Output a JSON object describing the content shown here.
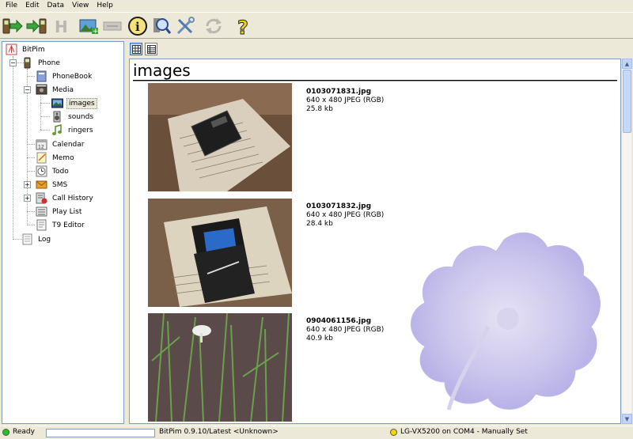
{
  "menubar": {
    "items": [
      "File",
      "Edit",
      "Data",
      "View",
      "Help"
    ]
  },
  "toolbar": {
    "buttons": [
      {
        "name": "get-phone-data",
        "icon": "phone-arrow-in-icon"
      },
      {
        "name": "send-phone-data",
        "icon": "phone-arrow-out-icon"
      },
      {
        "name": "history",
        "icon": "h-icon"
      },
      {
        "name": "add-image",
        "icon": "image-add-icon"
      },
      {
        "name": "delete",
        "icon": "delete-icon"
      },
      {
        "name": "info",
        "icon": "info-icon"
      },
      {
        "name": "find-phone",
        "icon": "magnifier-phone-icon"
      },
      {
        "name": "settings",
        "icon": "tools-icon"
      },
      {
        "name": "refresh",
        "icon": "refresh-icon"
      },
      {
        "name": "help",
        "icon": "help-icon"
      }
    ]
  },
  "tree": {
    "root": "BitPim",
    "phone": "Phone",
    "phonebook": "PhoneBook",
    "media": "Media",
    "images": "images",
    "sounds": "sounds",
    "ringers": "ringers",
    "calendar": "Calendar",
    "memo": "Memo",
    "todo": "Todo",
    "sms": "SMS",
    "call_history": "Call History",
    "play_list": "Play List",
    "t9_editor": "T9 Editor",
    "log": "Log"
  },
  "content": {
    "heading": "images",
    "items": [
      {
        "filename": "0103071831.jpg",
        "dims": "640 x 480 JPEG (RGB)",
        "size": "25.8 kb"
      },
      {
        "filename": "0103071832.jpg",
        "dims": "640 x 480 JPEG (RGB)",
        "size": "28.4 kb"
      },
      {
        "filename": "0904061156.jpg",
        "dims": "640 x 480 JPEG (RGB)",
        "size": "40.9 kb"
      }
    ]
  },
  "status": {
    "ready": "Ready",
    "version": "BitPim 0.9.10/Latest <Unknown>",
    "phone": "LG-VX5200 on COM4 - Manually Set",
    "ready_color": "#22c322",
    "phone_color": "#f2d800"
  }
}
